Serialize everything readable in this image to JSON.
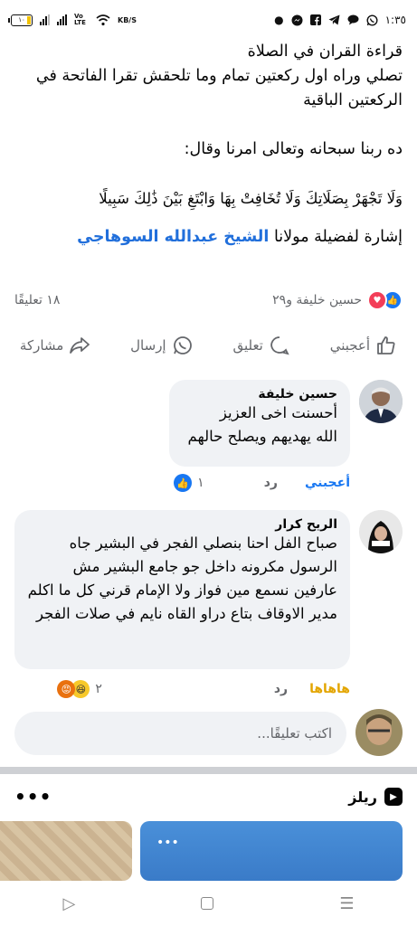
{
  "status_bar": {
    "time": "١:٣٥",
    "battery": "١٠",
    "network_speed": "KB/S",
    "volte": "Vo LTE"
  },
  "post": {
    "lines": [
      "قراءة القران في الصلاة",
      "تصلي وراه اول ركعتين تمام وما تلحقش تقرا الفاتحة في الركعتين الباقية",
      "",
      "ده ربنا سبحانه وتعالى امرنا وقال:",
      "",
      "وَلَا تَجْهَرْ بِصَلَاتِكَ وَلَا تُخَافِتْ بِهَا وَابْتَغِ بَيْنَ ذَٰلِكَ سَبِيلًا",
      ""
    ],
    "mention_prefix": "إشارة لفضيلة مولانا",
    "mention_name": "الشيخ عبدالله السوهاجي"
  },
  "reactions": {
    "summary": "حسين خليفة و٢٩",
    "comments_count": "١٨ تعليقًا"
  },
  "actions": {
    "like": "أعجبني",
    "comment": "تعليق",
    "send": "إرسال",
    "share": "مشاركة"
  },
  "comments": [
    {
      "name": "حسين خليفة",
      "text": "أحسنت اخى العزيز\nالله يهديهم ويصلح حالهم",
      "reaction_label": "أعجبني",
      "reply": "رد",
      "reaction_count": "١",
      "reaction_color": "#1877f2"
    },
    {
      "name": "الريح كرار",
      "text": "صباح الفل احنا بنصلي الفجر في البشير  جاه الرسول مكرونه داخل جو جامع البشير مش عارفين نسمع مين فواز ولا الإمام قرني كل ما اكلم مدير الاوقاف بتاع دراو القاه نايم في صلات الفجر",
      "reaction_label": "هاهاها",
      "reply": "رد",
      "reaction_count": "٢",
      "reaction_color": "#e3a500"
    }
  ],
  "write_comment": {
    "placeholder": "اكتب تعليقًا..."
  },
  "reels": {
    "title": "ريلز",
    "more": "•••"
  }
}
